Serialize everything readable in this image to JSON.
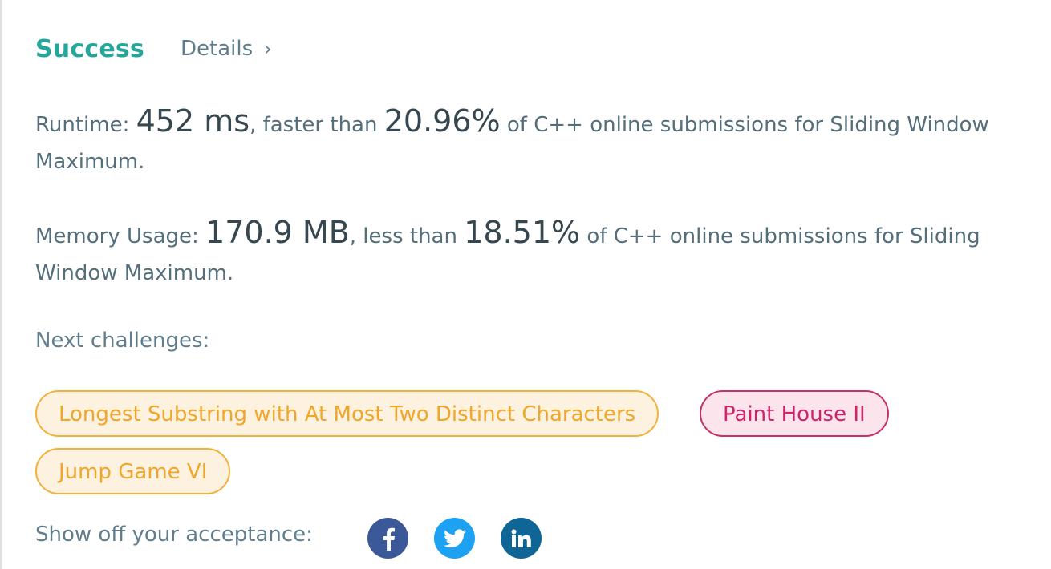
{
  "result": {
    "status": "Success",
    "details_label": "Details",
    "chevron": "›"
  },
  "runtime": {
    "label": "Runtime:",
    "value": "452 ms",
    "comparison": ", faster than",
    "percent": "20.96%",
    "suffix": "of C++ online submissions for Sliding Window Maximum."
  },
  "memory": {
    "label": "Memory Usage:",
    "value": "170.9 MB",
    "comparison": ", less than",
    "percent": "18.51%",
    "suffix": "of C++ online submissions for Sliding Window Maximum."
  },
  "next_challenges": {
    "label": "Next challenges:",
    "items": [
      {
        "title": "Longest Substring with At Most Two Distinct Characters",
        "difficulty": "medium",
        "color": "#f0a62a"
      },
      {
        "title": "Paint House II",
        "difficulty": "hard",
        "color": "#d0236a"
      },
      {
        "title": "Jump Game VI",
        "difficulty": "medium",
        "color": "#f0a62a"
      }
    ]
  },
  "share": {
    "label": "Show off your acceptance:",
    "icons": [
      {
        "name": "facebook-icon",
        "color": "#3b5998"
      },
      {
        "name": "twitter-icon",
        "color": "#1da1f2"
      },
      {
        "name": "linkedin-icon",
        "color": "#0e6596"
      }
    ]
  },
  "colors": {
    "success": "#26a69a",
    "text": "#546e7a"
  }
}
